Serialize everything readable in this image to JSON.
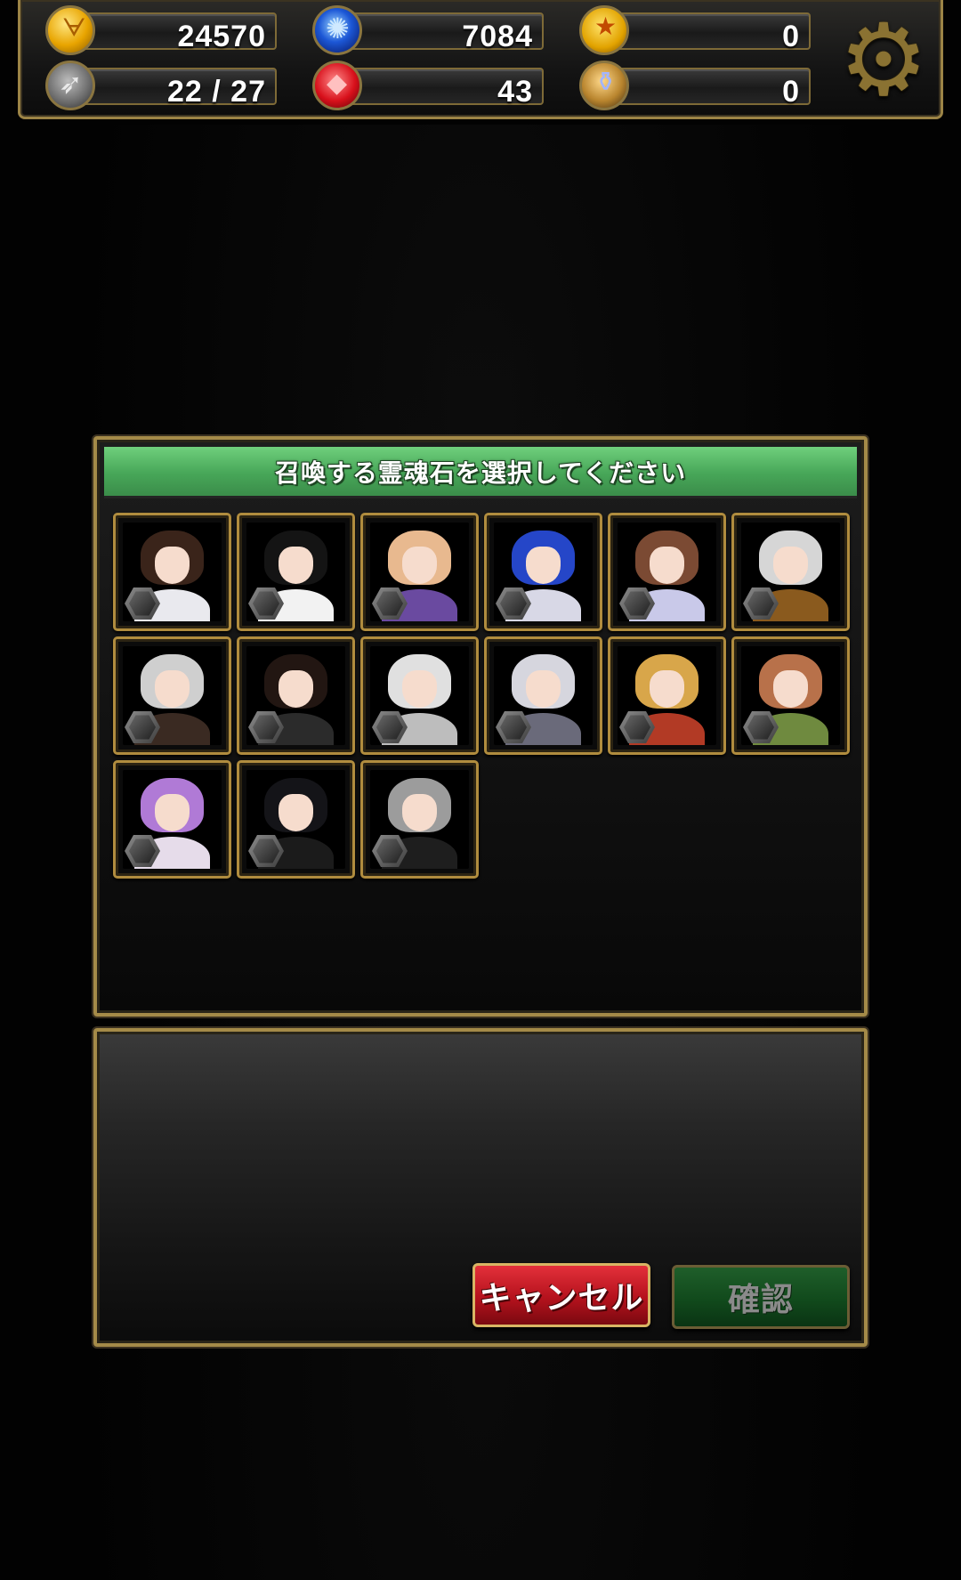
{
  "status_bar": {
    "gold": "24570",
    "stamina": "22 / 27",
    "mana_orbs": "7084",
    "gems": "43",
    "medals": "0",
    "potions": "0",
    "icons": {
      "gold": "gold-coin-icon",
      "stamina": "winged-boot-icon",
      "mana_orbs": "blue-orb-icon",
      "gems": "red-gem-icon",
      "medals": "medal-icon",
      "potions": "potion-icon",
      "settings": "gear-icon"
    }
  },
  "dialog": {
    "title": "召喚する霊魂石を選択してください",
    "cards": [
      {
        "id": "card-1",
        "hair": "#3a241a",
        "body": "#e9e9ee"
      },
      {
        "id": "card-2",
        "hair": "#141414",
        "body": "#f2f2f2"
      },
      {
        "id": "card-3",
        "hair": "#e8b98f",
        "body": "#6a4aa0"
      },
      {
        "id": "card-4",
        "hair": "#2546c8",
        "body": "#d8d8e6"
      },
      {
        "id": "card-5",
        "hair": "#7b4a33",
        "body": "#c9c9e9"
      },
      {
        "id": "card-6",
        "hair": "#d6d6d6",
        "body": "#8a5a1e"
      },
      {
        "id": "card-7",
        "hair": "#cfcfcf",
        "body": "#3a2a22"
      },
      {
        "id": "card-8",
        "hair": "#221612",
        "body": "#2b2b2b"
      },
      {
        "id": "card-9",
        "hair": "#e0e0e0",
        "body": "#bdbdbd"
      },
      {
        "id": "card-10",
        "hair": "#d6d6de",
        "body": "#6a6a7a"
      },
      {
        "id": "card-11",
        "hair": "#d8a64a",
        "body": "#b23a25"
      },
      {
        "id": "card-12",
        "hair": "#b8714a",
        "body": "#6f8a3f"
      },
      {
        "id": "card-13",
        "hair": "#b07ad6",
        "body": "#e6dcea"
      },
      {
        "id": "card-14",
        "hair": "#141418",
        "body": "#1b1b1b"
      },
      {
        "id": "card-15",
        "hair": "#9c9c9c",
        "body": "#1e1e1e"
      }
    ]
  },
  "buttons": {
    "cancel_label": "キャンセル",
    "confirm_label": "確認"
  },
  "colors": {
    "frame_gold": "#a48a48",
    "header_green": "#47a658",
    "cancel_red": "#b5121d",
    "confirm_green": "#114a1c"
  }
}
